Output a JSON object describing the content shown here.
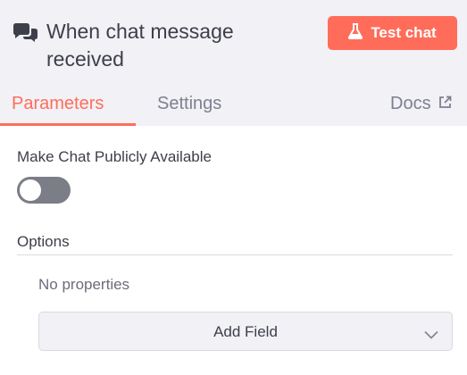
{
  "header": {
    "title": "When chat message received",
    "title_icon": "chat-bubbles-icon",
    "test_button_label": "Test chat",
    "test_button_icon": "flask-icon",
    "accent_color": "#ff6d5a"
  },
  "tabs": [
    {
      "label": "Parameters",
      "active": true
    },
    {
      "label": "Settings",
      "active": false
    },
    {
      "label": "Docs",
      "active": false,
      "icon": "external-link-icon"
    }
  ],
  "params": {
    "public_label": "Make Chat Publicly Available",
    "public_enabled": false,
    "options_label": "Options",
    "no_properties": "No properties",
    "add_field_label": "Add Field",
    "add_field_icon": "chevron-down-icon"
  }
}
